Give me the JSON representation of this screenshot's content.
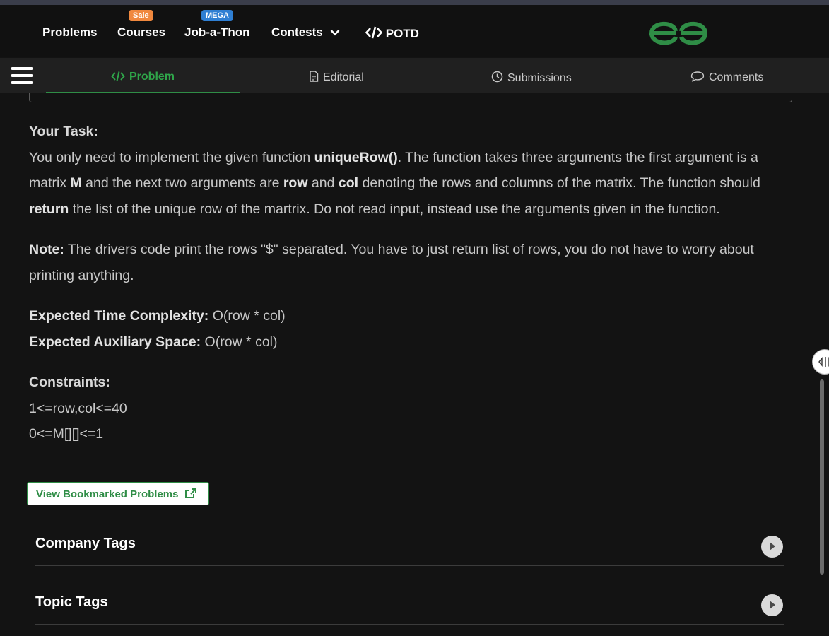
{
  "nav": {
    "problems": "Problems",
    "courses": "Courses",
    "courses_badge": "Sale",
    "jobathon": "Job-a-Thon",
    "jobathon_badge": "MEGA",
    "contests": "Contests",
    "potd": "POTD"
  },
  "tabs": {
    "problem": "Problem",
    "editorial": "Editorial",
    "submissions": "Submissions",
    "comments": "Comments"
  },
  "task": {
    "heading": "Your Task:",
    "t1": "You only need to implement the given function ",
    "fn": "uniqueRow()",
    "t2": ". The function takes three arguments the first argument is a matrix ",
    "m": "M",
    "t3": " and the next two arguments are ",
    "row": "row",
    "t4": " and ",
    "col": "col",
    "t5": " denoting the rows and columns of the matrix. The function should ",
    "ret": "return",
    "t6": " the list of the unique row of the martrix. Do not read input, instead use the arguments given in the function."
  },
  "note": {
    "label": "Note:",
    "text": " The drivers code print the rows \"$\" separated. You have to just return list of rows, you do not have to worry about printing anything."
  },
  "complexity": {
    "time_label": "Expected Time Complexity:",
    "time_value": " O(row * col)",
    "space_label": "Expected Auxiliary Space:",
    "space_value": " O(row * col)"
  },
  "constraints": {
    "heading": "Constraints:",
    "line1": "1<=row,col<=40",
    "line2": "0<=M[][]<=1"
  },
  "bookmark_button": "View Bookmarked Problems",
  "tags": {
    "company": "Company Tags",
    "topic": "Topic Tags"
  },
  "colors": {
    "brand_green": "#2f8d46",
    "background": "#131313",
    "badge_sale": "#f0883e",
    "badge_mega": "#2f7fd3"
  }
}
